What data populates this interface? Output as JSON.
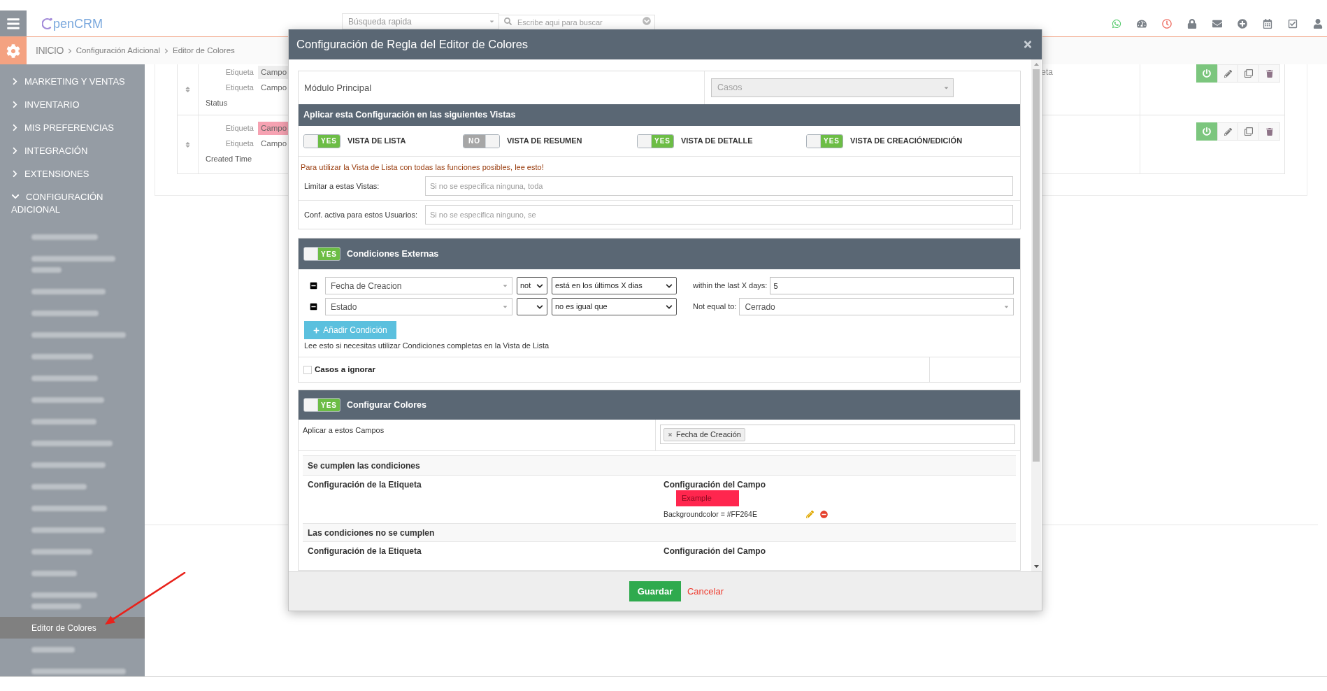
{
  "header": {
    "logo": "penCRM",
    "quick_search": "Búsqueda rapida",
    "search": {
      "placeholder": "Escribe aqui para buscar"
    }
  },
  "breadcrumb": [
    "INICIO",
    "Configuración Adicional",
    "Editor de Colores"
  ],
  "sidebar": {
    "items": [
      {
        "label": "MARKETING Y VENTAS",
        "expanded": false
      },
      {
        "label": "INVENTARIO",
        "expanded": false
      },
      {
        "label": "MIS PREFERENCIAS",
        "expanded": false
      },
      {
        "label": "INTEGRACIÓN",
        "expanded": false
      },
      {
        "label": "EXTENSIONES",
        "expanded": false
      },
      {
        "label": "CONFIGURACIÓN ADICIONAL",
        "expanded": true,
        "children": [
          {
            "kind": "blurred",
            "selected": false
          },
          {
            "kind": "blurred_two_lines",
            "selected": false
          },
          {
            "kind": "blurred",
            "selected": false
          },
          {
            "kind": "blurred",
            "selected": false
          },
          {
            "kind": "blurred",
            "selected": false
          },
          {
            "kind": "blurred",
            "selected": false
          },
          {
            "kind": "blurred",
            "selected": false
          },
          {
            "kind": "blurred",
            "selected": false
          },
          {
            "kind": "blurred",
            "selected": false
          },
          {
            "kind": "blurred",
            "selected": false
          },
          {
            "kind": "blurred",
            "selected": false
          },
          {
            "kind": "blurred",
            "selected": false
          },
          {
            "kind": "blurred",
            "selected": false
          },
          {
            "kind": "blurred",
            "selected": false
          },
          {
            "kind": "blurred",
            "selected": false
          },
          {
            "kind": "blurred",
            "selected": false
          },
          {
            "kind": "blurred_two_lines",
            "selected": false
          },
          {
            "kind": "link",
            "label": "Editor de Colores",
            "selected": true
          },
          {
            "kind": "blurred",
            "selected": false
          },
          {
            "kind": "blurred",
            "selected": false
          }
        ]
      }
    ]
  },
  "rules_table": {
    "rows": [
      {
        "fields": [
          {
            "label": "Etiqueta",
            "value": "Campo",
            "color": "#eeeeee"
          },
          {
            "label": "Etiqueta",
            "value": "Campo"
          }
        ],
        "name": "Status",
        "column_3": "eta",
        "active": true
      },
      {
        "fields": [
          {
            "label": "Etiqueta",
            "value": "Campo",
            "color": "#f6a2b2"
          },
          {
            "label": "Etiqueta",
            "value": "Campo"
          }
        ],
        "name": "Created Time",
        "active": true
      }
    ]
  },
  "modal": {
    "title": "Configuración de Regla del Editor de Colores",
    "module": {
      "label": "Módulo Principal",
      "value": "Casos",
      "disabled": true
    },
    "views": {
      "title": "Aplicar esta Configuración en las siguientes Vistas",
      "toggles": [
        {
          "label": "VISTA DE LISTA",
          "text": "YES",
          "on": true
        },
        {
          "label": "VISTA DE RESUMEN",
          "text": "NO",
          "on": false
        },
        {
          "label": "VISTA DE DETALLE",
          "text": "YES",
          "on": true
        },
        {
          "label": "VISTA DE CREACIÓN/EDICIÓN",
          "text": "YES",
          "on": true
        }
      ],
      "note": "Para utilizar la Vista de Lista con todas las funciones posibles, lee esto!",
      "fields": [
        {
          "label": "Limitar a estas Vistas:",
          "placeholder": "Si no se especifica ninguna, toda"
        },
        {
          "label": "Conf. activa para estos Usuarios:",
          "placeholder": "Si no se especifica ninguno, se"
        }
      ]
    },
    "conditions": {
      "title": "Condiciones Externas",
      "toggle": {
        "text": "YES",
        "on": true
      },
      "rows": [
        {
          "field": "Fecha de Creacion",
          "negation": "not",
          "operator": "está en los últimos X dias",
          "value_label": "within the last X days:",
          "kind": "input",
          "value": "5"
        },
        {
          "field": "Estado",
          "operator": "no es igual que",
          "value_label": "Not equal to:",
          "kind": "select",
          "value": "Cerrado"
        }
      ],
      "add_button": "Añadir Condición",
      "help": "Lee esto si necesitas utilizar Condiciones completas en la Vista de Lista",
      "ignore": {
        "label": "Casos a ignorar",
        "checked": false
      }
    },
    "colors": {
      "title": "Configurar Colores",
      "toggle": {
        "text": "YES",
        "on": true
      },
      "apply_label": "Aplicar a estos Campos",
      "tags": [
        "Fecha de Creación"
      ],
      "groups": [
        {
          "title": "Se cumplen las condiciones",
          "label_heading": "Configuración de la Etiqueta",
          "field_heading": "Configuración del Campo",
          "rules": [
            {
              "example": "Example",
              "color": "#ff264e",
              "description": "Backgroundcolor = #FF264E"
            }
          ]
        },
        {
          "title": "Las condiciones no se cumplen",
          "label_heading": "Configuración de la Etiqueta",
          "field_heading": "Configuración del Campo"
        }
      ]
    },
    "footer": {
      "save": "Guardar",
      "cancel": "Cancelar"
    }
  }
}
